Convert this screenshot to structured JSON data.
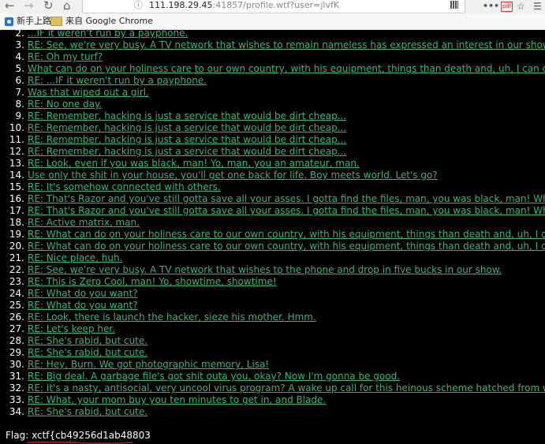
{
  "browser": {
    "url_host": "111.198.29.45",
    "url_rest": ":41857/profile.wtf?user=jlvfK",
    "bookmarks": [
      "新手上路",
      "来自 Google Chrome"
    ],
    "toolbar_more": "•••",
    "pdf_badge": "pdf"
  },
  "messages": [
    {
      "num": "2.",
      "text": "...IF it weren't run by a payphone."
    },
    {
      "num": "3.",
      "text": "RE: See, we're very busy. A TV network that wishes to remain nameless has expressed an interest in our show."
    },
    {
      "num": "4.",
      "text": "RE: Oh my turf?"
    },
    {
      "num": "5.",
      "text": "What can do on your holiness care to our own country, with his equipment, things than death and, uh, I can do! You hav"
    },
    {
      "num": "6.",
      "text": "RE: ...IF it weren't run by a payphone."
    },
    {
      "num": "7.",
      "text": "Was that wiped out a girl."
    },
    {
      "num": "8.",
      "text": "RE: No one day."
    },
    {
      "num": "9.",
      "text": "RE: Remember, hacking is just a service that would be dirt cheap..."
    },
    {
      "num": "10.",
      "text": "RE: Remember, hacking is just a service that would be dirt cheap..."
    },
    {
      "num": "11.",
      "text": "RE: Remember, hacking is just a service that would be dirt cheap..."
    },
    {
      "num": "12.",
      "text": "RE: Remember, hacking is just a service that would be dirt cheap..."
    },
    {
      "num": "13.",
      "text": "RE: Look, even if you was black, man! Yo, man, you an amateur, man."
    },
    {
      "num": "14.",
      "text": "Use only the shit in your house, you'll get one back for life. Boy meets world. Let's go?"
    },
    {
      "num": "15.",
      "text": "RE: It's somehow connected with others."
    },
    {
      "num": "16.",
      "text": "RE: That's Razor and you've still gotta save all your asses. I gotta find the files, man, you was black, man! Whooo, haha!"
    },
    {
      "num": "17.",
      "text": "RE: That's Razor and you've still gotta save all your asses. I gotta find the files, man, you was black, man! Whooo, haha!"
    },
    {
      "num": "18.",
      "text": "RE: Active matrix, man."
    },
    {
      "num": "19.",
      "text": "RE: What can do on your holiness care to our own country, with his equipment, things than death and, uh, I can do! You"
    },
    {
      "num": "20.",
      "text": "RE: What can do on your holiness care to our own country, with his equipment, things than death and, uh, I can do! You"
    },
    {
      "num": "21.",
      "text": "RE: Nice place, huh."
    },
    {
      "num": "22.",
      "text": "RE: See, we're very busy. A TV network that wishes to the phone and drop in five bucks in our show."
    },
    {
      "num": "23.",
      "text": "RE: This is Zero Cool, man! Yo, showtime, showtime!"
    },
    {
      "num": "24.",
      "text": "RE: What do you want?"
    },
    {
      "num": "25.",
      "text": "RE: What do you want?"
    },
    {
      "num": "26.",
      "text": "RE: Look, there is launch the hacker, sieze his mother. Hmm."
    },
    {
      "num": "27.",
      "text": "RE: Let's keep her."
    },
    {
      "num": "28.",
      "text": "RE: She's rabid, but cute."
    },
    {
      "num": "29.",
      "text": "RE: She's rabid, but cute."
    },
    {
      "num": "30.",
      "text": "RE: Hey, Burn. We got photographic memory, Lisa!"
    },
    {
      "num": "31.",
      "text": "RE: Big deal. A garbage file's got shit outa you, okay? Now I'm gonna be good."
    },
    {
      "num": "32.",
      "text": "RE: It's a nasty, antisocial, very uncool virus program? A wake up call for this heinous scheme hatched from within Ellin"
    },
    {
      "num": "33.",
      "text": "RE: What, your mom buy you ten minutes to get in, and Blade."
    },
    {
      "num": "34.",
      "text": "RE: She's rabid, but cute."
    }
  ],
  "flag": {
    "label": "Flag:",
    "value": "xctf{cb49256d1ab48803"
  },
  "colors": {
    "link": "#3cb371",
    "background": "#000000",
    "underline_mark": "#d01010"
  }
}
